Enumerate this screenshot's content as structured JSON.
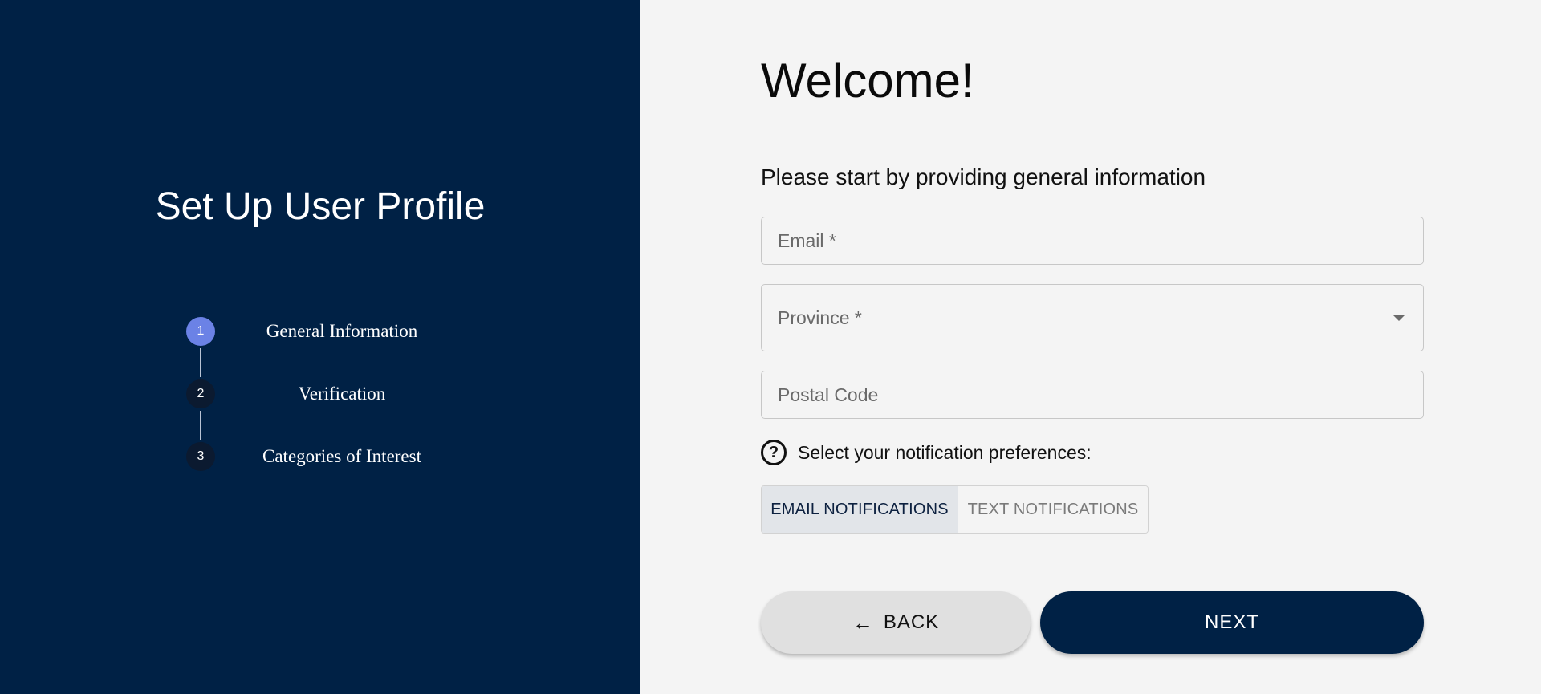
{
  "left_panel": {
    "title": "Set Up User Profile",
    "steps": [
      {
        "number": "1",
        "label": "General Information",
        "active": true
      },
      {
        "number": "2",
        "label": "Verification",
        "active": false
      },
      {
        "number": "3",
        "label": "Categories of Interest",
        "active": false
      }
    ]
  },
  "form": {
    "heading": "Welcome!",
    "subtitle": "Please start by providing general information",
    "email": {
      "placeholder": "Email *",
      "value": ""
    },
    "province": {
      "label": "Province *",
      "value": ""
    },
    "postal_code": {
      "placeholder": "Postal Code",
      "value": ""
    },
    "notifications": {
      "label": "Select your notification preferences:",
      "help_icon": "question-circle-icon",
      "options": [
        {
          "label": "EMAIL NOTIFICATIONS",
          "selected": true
        },
        {
          "label": "TEXT NOTIFICATIONS",
          "selected": false
        }
      ]
    },
    "back_label": "BACK",
    "back_icon": "arrow-left-icon",
    "next_label": "NEXT"
  },
  "colors": {
    "panel_bg": "#002145",
    "active_step": "#6b82e6",
    "inactive_step": "#0b1a30",
    "page_bg": "#f4f4f4"
  }
}
